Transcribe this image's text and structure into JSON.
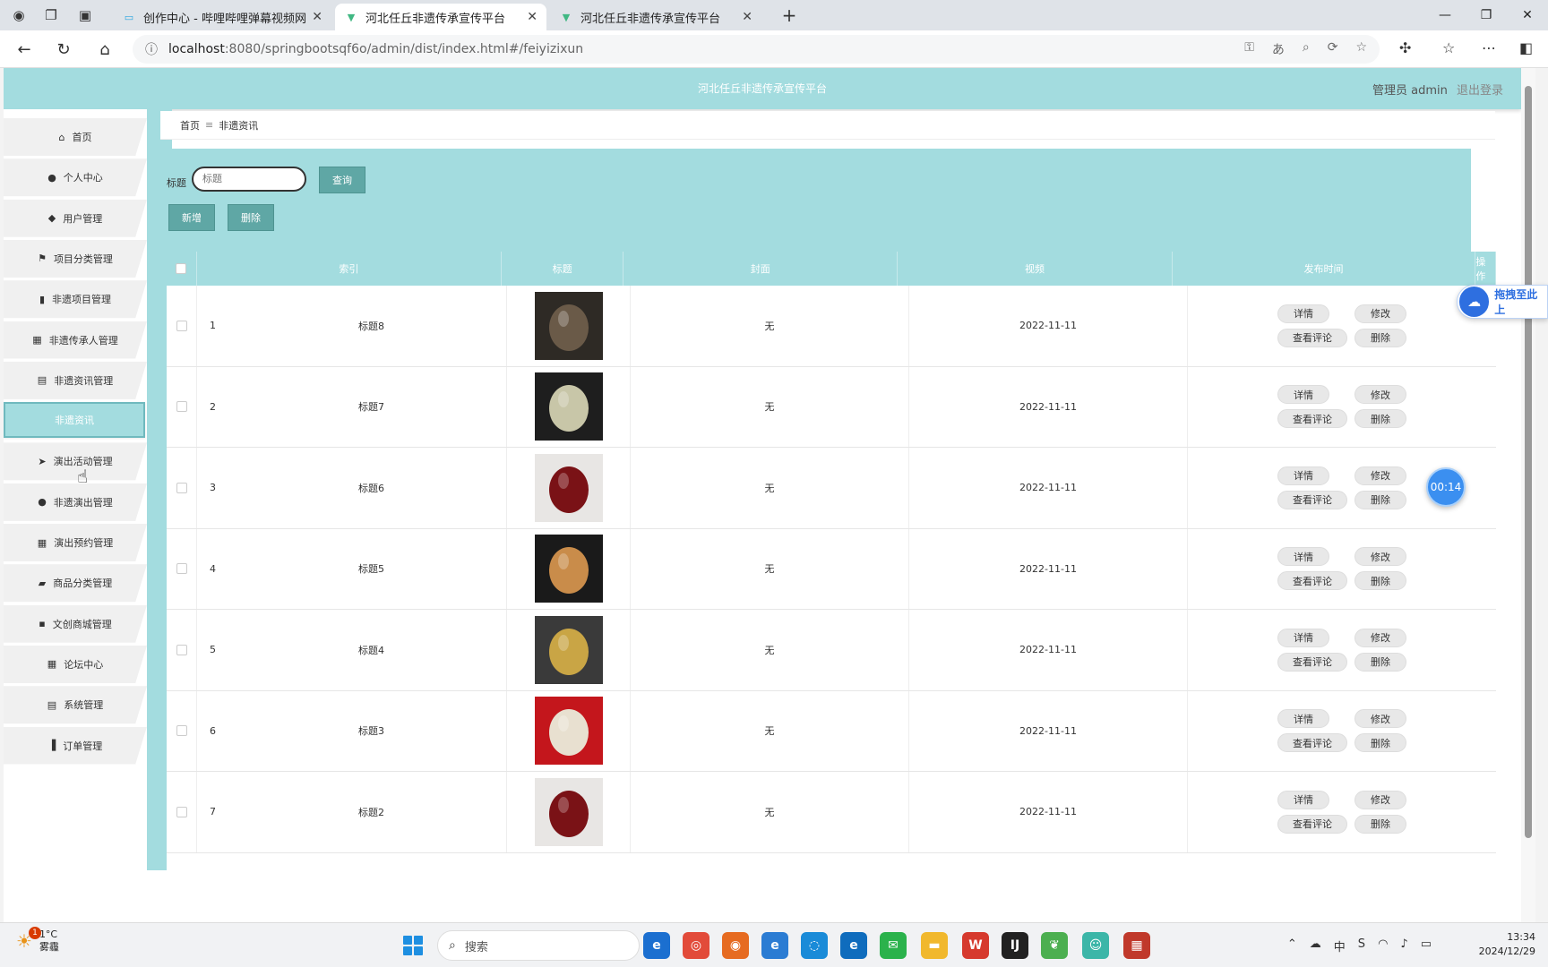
{
  "browser": {
    "tabs": [
      {
        "title": "创作中心 - 哔哩哔哩弹幕视频网",
        "favicon": "bilibili-icon"
      },
      {
        "title": "河北任丘非遗传承宣传平台",
        "favicon": "vue-icon"
      },
      {
        "title": "河北任丘非遗传承宣传平台",
        "favicon": "vue-icon"
      }
    ],
    "url_host": "localhost",
    "url_rest": ":8080/springbootsqf6o/admin/dist/index.html#/feiyizixun"
  },
  "header": {
    "site_title": "河北任丘非遗传承宣传平台",
    "user_label": "管理员 admin",
    "logout_label": "退出登录"
  },
  "sidebar": {
    "items": [
      {
        "label": "首页",
        "icon": "home-icon"
      },
      {
        "label": "个人中心",
        "icon": "person-icon"
      },
      {
        "label": "用户管理",
        "icon": "pin-icon"
      },
      {
        "label": "项目分类管理",
        "icon": "flag-icon"
      },
      {
        "label": "非遗项目管理",
        "icon": "book-icon"
      },
      {
        "label": "非遗传承人管理",
        "icon": "grid-icon"
      },
      {
        "label": "非遗资讯管理",
        "icon": "doc-icon"
      },
      {
        "label": "非遗资讯",
        "icon": "",
        "active": true
      },
      {
        "label": "演出活动管理",
        "icon": "send-icon"
      },
      {
        "label": "非遗演出管理",
        "icon": "person-icon"
      },
      {
        "label": "演出预约管理",
        "icon": "grid-icon"
      },
      {
        "label": "商品分类管理",
        "icon": "ticket-icon"
      },
      {
        "label": "文创商城管理",
        "icon": "chat-icon"
      },
      {
        "label": "论坛中心",
        "icon": "grid-icon"
      },
      {
        "label": "系统管理",
        "icon": "doc-icon"
      },
      {
        "label": "订单管理",
        "icon": "chart-icon"
      }
    ]
  },
  "breadcrumb": {
    "home": "首页",
    "separator": "≡",
    "current": "非遗资讯"
  },
  "search": {
    "label": "标题",
    "placeholder": "标题",
    "query_button": "查询",
    "add_button": "新增",
    "delete_button": "删除"
  },
  "table": {
    "headers": [
      "",
      "索引",
      "标题",
      "封面",
      "视频",
      "发布时间",
      "操作"
    ],
    "ops": {
      "detail": "详情",
      "edit": "修改",
      "comments": "查看评论",
      "delete": "删除"
    },
    "rows": [
      {
        "index": "1",
        "title": "标题8",
        "video": "无",
        "date": "2022-11-11",
        "cover_colors": [
          "#6a5a48",
          "#2e2a25"
        ]
      },
      {
        "index": "2",
        "title": "标题7",
        "video": "无",
        "date": "2022-11-11",
        "cover_colors": [
          "#c8c6a8",
          "#1e1e1e"
        ]
      },
      {
        "index": "3",
        "title": "标题6",
        "video": "无",
        "date": "2022-11-11",
        "cover_colors": [
          "#7a1216",
          "#e8e6e4"
        ]
      },
      {
        "index": "4",
        "title": "标题5",
        "video": "无",
        "date": "2022-11-11",
        "cover_colors": [
          "#c98c4a",
          "#1a1a1a"
        ]
      },
      {
        "index": "5",
        "title": "标题4",
        "video": "无",
        "date": "2022-11-11",
        "cover_colors": [
          "#c9a545",
          "#3a3a3a"
        ]
      },
      {
        "index": "6",
        "title": "标题3",
        "video": "无",
        "date": "2022-11-11",
        "cover_colors": [
          "#e8e0d0",
          "#c4161c"
        ]
      },
      {
        "index": "7",
        "title": "标题2",
        "video": "无",
        "date": "2022-11-11",
        "cover_colors": [
          "#7a1216",
          "#e8e6e4"
        ]
      }
    ]
  },
  "overlay": {
    "drag_label": "拖拽至此上",
    "timer": "00:14"
  },
  "taskbar": {
    "weather_temp": "1°C",
    "weather_desc": "雾霾",
    "notification_count": "1",
    "search_placeholder": "搜索",
    "ime": "中",
    "time": "13:34",
    "date": "2024/12/29"
  },
  "colors": {
    "accent": "#a3dcdf",
    "button": "#5fa7a5"
  }
}
